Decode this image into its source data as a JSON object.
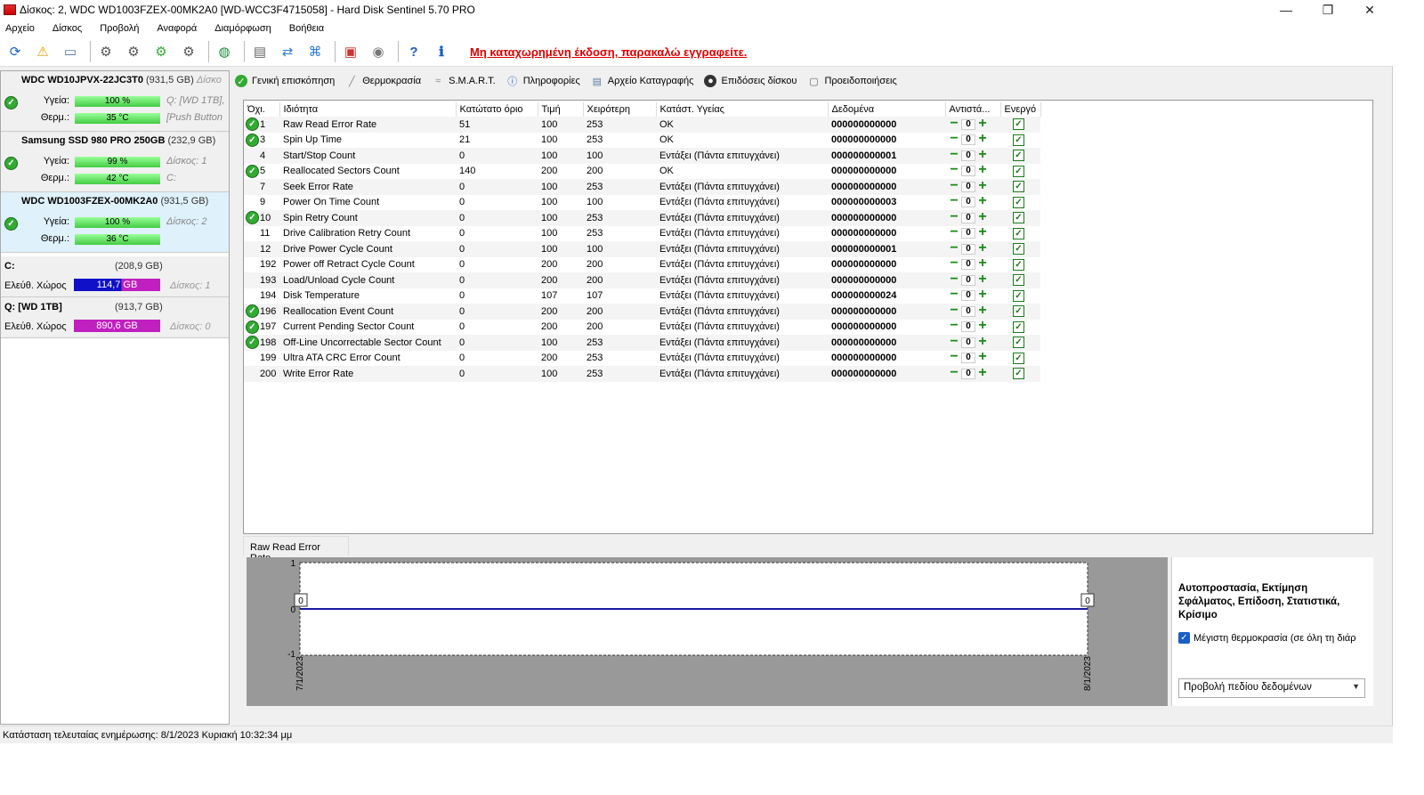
{
  "window": {
    "title": "Δίσκος: 2, WDC WD1003FZEX-00MK2A0 [WD-WCC3F4715058]  -  Hard Disk Sentinel 5.70 PRO",
    "minimize": "—",
    "restore": "❐",
    "close": "✕"
  },
  "menu": [
    "Αρχείο",
    "Δίσκος",
    "Προβολή",
    "Αναφορά",
    "Διαμόρφωση",
    "Βοήθεια"
  ],
  "toolbar": {
    "icons": [
      "refresh-icon",
      "warning-icon",
      "disk-icon",
      "test-icon-1",
      "test-icon-2",
      "test-icon-3",
      "test-icon-4",
      "globe-icon",
      "report-icon",
      "sync-icon",
      "network-icon",
      "chip-icon",
      "sound-icon",
      "help-icon",
      "info-icon"
    ],
    "unregistered": "Μη καταχωρημένη έκδοση, παρακαλώ εγγραφείτε."
  },
  "disks": [
    {
      "name": "WDC WD10JPVX-22JC3T0",
      "capacity": "(931,5 GB)",
      "extra": "Δίσκο",
      "health_label": "Υγεία:",
      "health": "100 %",
      "health_info": "Q: [WD 1TB],",
      "temp_label": "Θερμ.:",
      "temp": "35 °C",
      "temp_info": "[Push Button",
      "selected": false
    },
    {
      "name": "Samsung SSD 980 PRO 250GB",
      "capacity": "(232,9 GB)",
      "extra": "",
      "health_label": "Υγεία:",
      "health": "99 %",
      "health_info": "Δίσκος: 1",
      "temp_label": "Θερμ.:",
      "temp": "42 °C",
      "temp_info": "C:",
      "selected": false
    },
    {
      "name": "WDC WD1003FZEX-00MK2A0",
      "capacity": "(931,5 GB)",
      "extra": "",
      "health_label": "Υγεία:",
      "health": "100 %",
      "health_info": "Δίσκος: 2",
      "temp_label": "Θερμ.:",
      "temp": "36 °C",
      "temp_info": "",
      "selected": true
    }
  ],
  "volumes": [
    {
      "name": "C:",
      "size": "(208,9 GB)",
      "free_label": "Ελεύθ. Χώρος",
      "free": "114,7 GB",
      "disk": "Δίσκος: 1"
    },
    {
      "name": "Q: [WD 1TB]",
      "size": "(913,7 GB)",
      "free_label": "Ελεύθ. Χώρος",
      "free": "890,6 GB",
      "disk": "Δίσκος: 0"
    }
  ],
  "tabs": [
    "Γενική επισκόπηση",
    "Θερμοκρασία",
    "S.M.A.R.T.",
    "Πληροφορίες",
    "Αρχείο Καταγραφής",
    "Επιδόσεις δίσκου",
    "Προειδοποιήσεις"
  ],
  "smart": {
    "columns": [
      "Όχι.",
      "Ιδιότητα",
      "Κατώτατο όριο",
      "Τιμή",
      "Χειρότερη",
      "Κατάστ. Υγείας",
      "Δεδομένα",
      "Αντιστά...",
      "Ενεργό"
    ],
    "rows": [
      {
        "id": "1",
        "attr": "Raw Read Error Rate",
        "thr": "51",
        "val": "100",
        "worst": "253",
        "status": "OK",
        "data": "000000000000",
        "adj": "0",
        "ok": true
      },
      {
        "id": "3",
        "attr": "Spin Up Time",
        "thr": "21",
        "val": "100",
        "worst": "253",
        "status": "OK",
        "data": "000000000000",
        "adj": "0",
        "ok": true
      },
      {
        "id": "4",
        "attr": "Start/Stop Count",
        "thr": "0",
        "val": "100",
        "worst": "100",
        "status": "Εντάξει (Πάντα επιτυγχάνει)",
        "data": "000000000001",
        "adj": "0",
        "ok": false
      },
      {
        "id": "5",
        "attr": "Reallocated Sectors Count",
        "thr": "140",
        "val": "200",
        "worst": "200",
        "status": "OK",
        "data": "000000000000",
        "adj": "0",
        "ok": true
      },
      {
        "id": "7",
        "attr": "Seek Error Rate",
        "thr": "0",
        "val": "100",
        "worst": "253",
        "status": "Εντάξει (Πάντα επιτυγχάνει)",
        "data": "000000000000",
        "adj": "0",
        "ok": false
      },
      {
        "id": "9",
        "attr": "Power On Time Count",
        "thr": "0",
        "val": "100",
        "worst": "100",
        "status": "Εντάξει (Πάντα επιτυγχάνει)",
        "data": "000000000003",
        "adj": "0",
        "ok": false
      },
      {
        "id": "10",
        "attr": "Spin Retry Count",
        "thr": "0",
        "val": "100",
        "worst": "253",
        "status": "Εντάξει (Πάντα επιτυγχάνει)",
        "data": "000000000000",
        "adj": "0",
        "ok": true
      },
      {
        "id": "11",
        "attr": "Drive Calibration Retry Count",
        "thr": "0",
        "val": "100",
        "worst": "253",
        "status": "Εντάξει (Πάντα επιτυγχάνει)",
        "data": "000000000000",
        "adj": "0",
        "ok": false
      },
      {
        "id": "12",
        "attr": "Drive Power Cycle Count",
        "thr": "0",
        "val": "100",
        "worst": "100",
        "status": "Εντάξει (Πάντα επιτυγχάνει)",
        "data": "000000000001",
        "adj": "0",
        "ok": false
      },
      {
        "id": "192",
        "attr": "Power off Retract Cycle Count",
        "thr": "0",
        "val": "200",
        "worst": "200",
        "status": "Εντάξει (Πάντα επιτυγχάνει)",
        "data": "000000000000",
        "adj": "0",
        "ok": false
      },
      {
        "id": "193",
        "attr": "Load/Unload Cycle Count",
        "thr": "0",
        "val": "200",
        "worst": "200",
        "status": "Εντάξει (Πάντα επιτυγχάνει)",
        "data": "000000000000",
        "adj": "0",
        "ok": false
      },
      {
        "id": "194",
        "attr": "Disk Temperature",
        "thr": "0",
        "val": "107",
        "worst": "107",
        "status": "Εντάξει (Πάντα επιτυγχάνει)",
        "data": "000000000024",
        "adj": "0",
        "ok": false
      },
      {
        "id": "196",
        "attr": "Reallocation Event Count",
        "thr": "0",
        "val": "200",
        "worst": "200",
        "status": "Εντάξει (Πάντα επιτυγχάνει)",
        "data": "000000000000",
        "adj": "0",
        "ok": true
      },
      {
        "id": "197",
        "attr": "Current Pending Sector Count",
        "thr": "0",
        "val": "200",
        "worst": "200",
        "status": "Εντάξει (Πάντα επιτυγχάνει)",
        "data": "000000000000",
        "adj": "0",
        "ok": true
      },
      {
        "id": "198",
        "attr": "Off-Line Uncorrectable Sector Count",
        "thr": "0",
        "val": "100",
        "worst": "253",
        "status": "Εντάξει (Πάντα επιτυγχάνει)",
        "data": "000000000000",
        "adj": "0",
        "ok": true
      },
      {
        "id": "199",
        "attr": "Ultra ATA CRC Error Count",
        "thr": "0",
        "val": "200",
        "worst": "253",
        "status": "Εντάξει (Πάντα επιτυγχάνει)",
        "data": "000000000000",
        "adj": "0",
        "ok": false
      },
      {
        "id": "200",
        "attr": "Write Error Rate",
        "thr": "0",
        "val": "100",
        "worst": "253",
        "status": "Εντάξει (Πάντα επιτυγχάνει)",
        "data": "000000000000",
        "adj": "0",
        "ok": false
      }
    ]
  },
  "chart": {
    "tab": "Raw Read Error Rate",
    "y_ticks": [
      "1",
      "0",
      "-1"
    ],
    "x_labels": [
      "7/1/2023",
      "8/1/2023"
    ],
    "point_labels": [
      "0",
      "0"
    ]
  },
  "chart_data": {
    "type": "line",
    "title": "Raw Read Error Rate",
    "x": [
      "7/1/2023",
      "8/1/2023"
    ],
    "series": [
      {
        "values": [
          0,
          0
        ]
      }
    ],
    "ylim": [
      -1,
      1
    ],
    "colors": {
      "line": "#1a1aa0"
    }
  },
  "right_panel": {
    "heading": "Αυτοπροστασία, Εκτίμηση Σφάλματος, Επίδοση, Στατιστικά, Κρίσιμο",
    "checkbox": "Μέγιστη θερμοκρασία (σε όλη τη διάρ",
    "select": "Προβολή πεδίου δεδομένων"
  },
  "status": "Κατάσταση τελευταίας ενημέρωσης: 8/1/2023 Κυριακή 10:32:34 μμ",
  "colors": {
    "accent": "#1a5fc4",
    "ok": "#33aa33",
    "free_c": "#1010c8",
    "free_q": "#c020c0",
    "error": "#dd0000"
  }
}
